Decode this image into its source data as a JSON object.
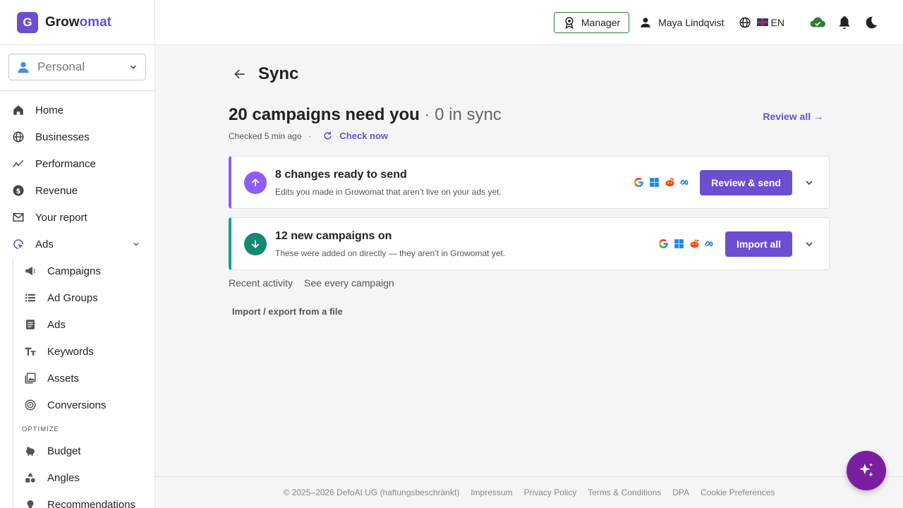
{
  "brand": {
    "badge": "G",
    "name_part1": "Grow",
    "name_part2": "omat",
    "color": "#6c4fd1"
  },
  "account": {
    "label": "Personal",
    "icon": "person-icon"
  },
  "sidebar": {
    "items": [
      {
        "label": "Home",
        "icon": "home-icon"
      },
      {
        "label": "Businesses",
        "icon": "globe-icon"
      },
      {
        "label": "Performance",
        "icon": "trend-icon"
      },
      {
        "label": "Revenue",
        "icon": "dollar-icon"
      },
      {
        "label": "Your report",
        "icon": "mail-icon"
      },
      {
        "label": "Ads",
        "icon": "cursor-icon"
      }
    ],
    "ads_subitems": [
      {
        "label": "Campaigns",
        "icon": "megaphone-icon"
      },
      {
        "label": "Ad Groups",
        "icon": "list-icon"
      },
      {
        "label": "Ads",
        "icon": "document-icon"
      },
      {
        "label": "Keywords",
        "icon": "text-icon"
      },
      {
        "label": "Assets",
        "icon": "image-icon"
      },
      {
        "label": "Conversions",
        "icon": "target-icon"
      }
    ],
    "optimize_label": "OPTIMIZE",
    "optimize_items": [
      {
        "label": "Budget",
        "icon": "piggybank-icon"
      },
      {
        "label": "Angles",
        "icon": "shapes-icon"
      },
      {
        "label": "Recommendations",
        "icon": "bulb-icon"
      }
    ]
  },
  "topbar": {
    "manager_label": "Manager",
    "user_name": "Maya Lindqvist",
    "language": "EN"
  },
  "page": {
    "title": "Sync",
    "headline": "20 campaigns need you",
    "headline_muted": " · 0 in sync",
    "review_all": "Review all →",
    "checked": "Checked 5 min ago",
    "dot": "·",
    "check_now": "Check now"
  },
  "cards": [
    {
      "title": "8 changes ready to send",
      "subtitle": "Edits you made in Growomat that aren’t live on your ads yet.",
      "button": "Review & send",
      "accent": "#8e5cf6"
    },
    {
      "title": "12 new campaigns on",
      "subtitle": "These were added on directly — they aren’t in Growomat yet.",
      "button": "Import all",
      "accent": "#138a72"
    }
  ],
  "tabs": [
    "Recent activity",
    "See every campaign"
  ],
  "file_link": "Import / export from a file",
  "footer": [
    "© 2025–2026 DefoAI UG (haftungsbeschränkt)",
    "Impressum",
    "Privacy Policy",
    "Terms & Conditions",
    "DPA",
    "Cookie Preferences"
  ]
}
